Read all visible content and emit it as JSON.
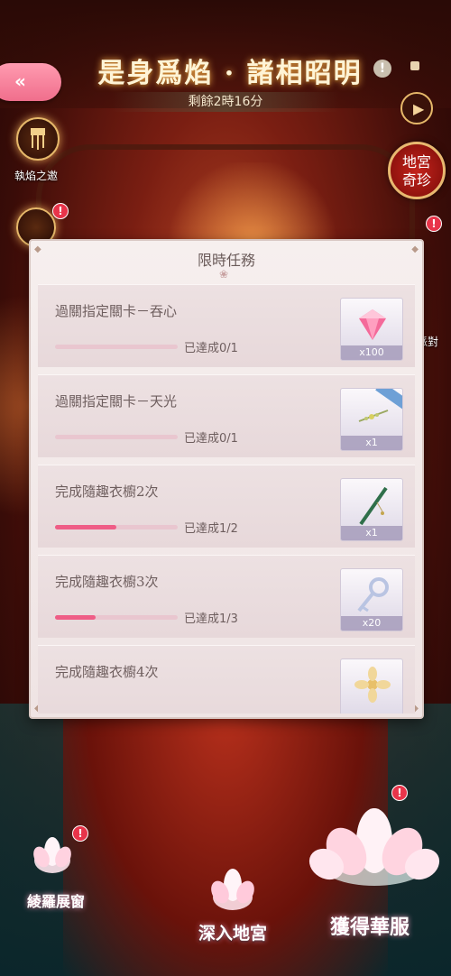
{
  "header": {
    "title": "是身爲焰 · 諸相昭明",
    "timer": "剩餘2時16分"
  },
  "left_menu": [
    {
      "label": "執焰之邀",
      "badge": ""
    },
    {
      "label": "",
      "badge": "!"
    }
  ],
  "right_menu": {
    "palace_button": "地宮\n奇珍",
    "party_label": "派對",
    "badge": "!"
  },
  "panel": {
    "title": "限時任務",
    "tasks": [
      {
        "name": "過關指定關卡－吞心",
        "progress_text": "已達成0/1",
        "progress": 0.0,
        "reward_icon": "pink-diamond-icon",
        "reward_count": "x100"
      },
      {
        "name": "過關指定關卡－天光",
        "progress_text": "已達成0/1",
        "progress": 0.0,
        "reward_icon": "hairpin-icon",
        "reward_count": "x1"
      },
      {
        "name": "完成隨趣衣櫥2次",
        "progress_text": "已達成1/2",
        "progress": 0.5,
        "reward_icon": "jade-flute-icon",
        "reward_count": "x1"
      },
      {
        "name": "完成隨趣衣櫥3次",
        "progress_text": "已達成1/3",
        "progress": 0.333,
        "reward_icon": "silver-key-icon",
        "reward_count": "x20"
      },
      {
        "name": "完成隨趣衣櫥4次",
        "progress_text": "",
        "progress": 0.0,
        "reward_icon": "gold-flower-icon",
        "reward_count": ""
      }
    ]
  },
  "bottom_nav": {
    "left": "綾羅展窗",
    "center": "深入地宮",
    "right": "獲得華服",
    "badge": "!"
  }
}
